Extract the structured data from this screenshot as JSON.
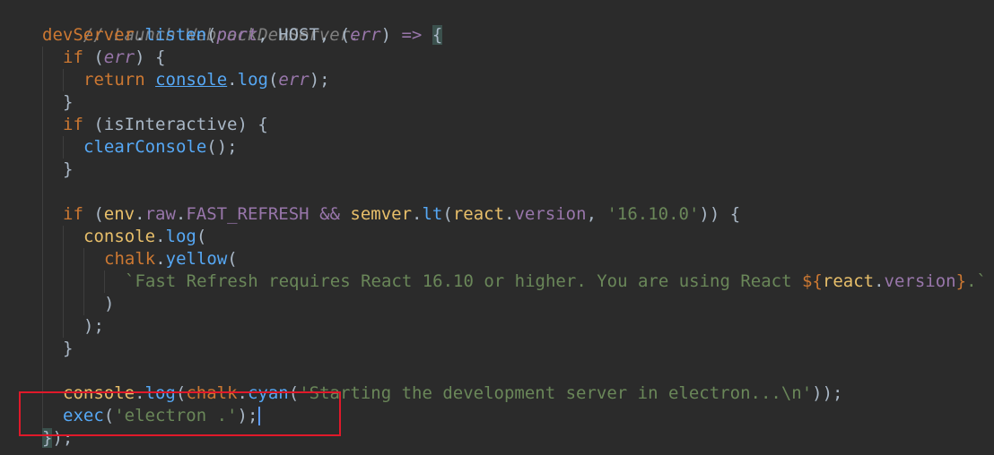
{
  "editor": {
    "highlight_color": "#e0192a",
    "lines": {
      "l1": {
        "comment": "// Launch WebpackDevServer."
      },
      "l2": {
        "obj": "devServer",
        "dot": ".",
        "fn": "listen",
        "p1": "(",
        "port": "port",
        "c1": ", ",
        "host": "HOST",
        "c2": ", ",
        "p2": "(",
        "err": "err",
        "p3": ") ",
        "arrow": "=>",
        "sp": " ",
        "brace": "{"
      },
      "l3": {
        "kw": "if",
        "p1": " (",
        "err": "err",
        "p2": ") {"
      },
      "l4": {
        "kw": "return",
        "sp": " ",
        "console": "console",
        "dot": ".",
        "fn": "log",
        "p1": "(",
        "err": "err",
        "p2": ");"
      },
      "l5": {
        "brace": "}"
      },
      "l6": {
        "kw": "if",
        "p1": " (",
        "var": "isInteractive",
        "p2": ") {"
      },
      "l7": {
        "fn": "clearConsole",
        "p": "();"
      },
      "l8": {
        "brace": "}"
      },
      "l10": {
        "kw": "if",
        "p1": " (",
        "env": "env",
        "d1": ".",
        "raw": "raw",
        "d2": ".",
        "fr": "FAST_REFRESH",
        "and": " && ",
        "semver": "semver",
        "d3": ".",
        "lt": "lt",
        "p2": "(",
        "react": "react",
        "d4": ".",
        "version": "version",
        "c": ", ",
        "str": "'16.10.0'",
        "p3": ")) {"
      },
      "l11": {
        "console": "console",
        "dot": ".",
        "fn": "log",
        "p": "("
      },
      "l12": {
        "chalk": "chalk",
        "dot": ".",
        "fn": "yellow",
        "p": "("
      },
      "l13": {
        "str1": "`Fast Refresh requires React 16.10 or higher. You are using React ",
        "tpl_open": "${",
        "react": "react",
        "dot": ".",
        "version": "version",
        "tpl_close": "}",
        "str2": ".`"
      },
      "l14": {
        "p": ")"
      },
      "l15": {
        "p": ");"
      },
      "l16": {
        "brace": "}"
      },
      "l18": {
        "console": "console",
        "d1": ".",
        "log": "log",
        "p1": "(",
        "chalk": "chalk",
        "d2": ".",
        "cyan": "cyan",
        "p2": "(",
        "str": "'Starting the development server in electron...\\n'",
        "p3": "));"
      },
      "l19": {
        "fn": "exec",
        "p1": "(",
        "str": "'electron .'",
        "p2": ");"
      },
      "l20": {
        "brace": "}",
        "p": ");"
      }
    }
  }
}
